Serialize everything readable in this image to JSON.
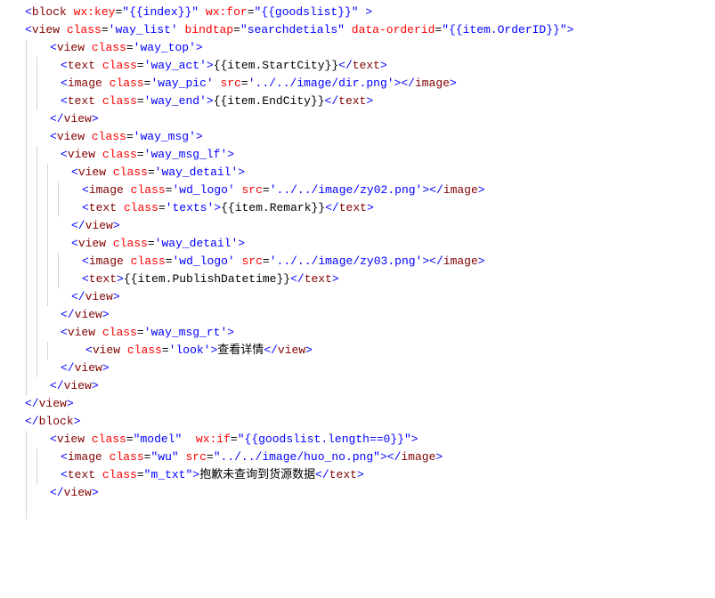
{
  "lines": [
    {
      "indent": 0,
      "parts": [
        {
          "t": "<",
          "c": "tag-angle"
        },
        {
          "t": "block",
          "c": "tag-name"
        },
        {
          "t": " "
        },
        {
          "t": "wx:key",
          "c": "attr-name"
        },
        {
          "t": "=",
          "c": "attr-eq"
        },
        {
          "t": "\"{{index}}\"",
          "c": "attr-value"
        },
        {
          "t": " "
        },
        {
          "t": "wx:for",
          "c": "attr-name"
        },
        {
          "t": "=",
          "c": "attr-eq"
        },
        {
          "t": "\"{{goodslist}}\"",
          "c": "attr-value"
        },
        {
          "t": " "
        },
        {
          "t": ">",
          "c": "tag-angle"
        }
      ],
      "guides": 0
    },
    {
      "indent": 0,
      "parts": [
        {
          "t": "<",
          "c": "tag-angle"
        },
        {
          "t": "view",
          "c": "tag-name"
        },
        {
          "t": " "
        },
        {
          "t": "class",
          "c": "attr-name"
        },
        {
          "t": "=",
          "c": "attr-eq"
        },
        {
          "t": "'way_list'",
          "c": "attr-value"
        },
        {
          "t": " "
        },
        {
          "t": "bindtap",
          "c": "attr-name"
        },
        {
          "t": "=",
          "c": "attr-eq"
        },
        {
          "t": "\"searchdetials\"",
          "c": "attr-value"
        },
        {
          "t": " "
        },
        {
          "t": "data-orderid",
          "c": "attr-name"
        },
        {
          "t": "=",
          "c": "attr-eq"
        },
        {
          "t": "\"{{item.OrderID}}\"",
          "c": "attr-value"
        },
        {
          "t": ">",
          "c": "tag-angle"
        }
      ],
      "guides": 0
    },
    {
      "indent": 2,
      "parts": [
        {
          "t": "<",
          "c": "tag-angle"
        },
        {
          "t": "view",
          "c": "tag-name"
        },
        {
          "t": " "
        },
        {
          "t": "class",
          "c": "attr-name"
        },
        {
          "t": "=",
          "c": "attr-eq"
        },
        {
          "t": "'way_top'",
          "c": "attr-value"
        },
        {
          "t": ">",
          "c": "tag-angle"
        }
      ],
      "guides": 1
    },
    {
      "indent": 3,
      "parts": [
        {
          "t": "<",
          "c": "tag-angle"
        },
        {
          "t": "text",
          "c": "tag-name"
        },
        {
          "t": " "
        },
        {
          "t": "class",
          "c": "attr-name"
        },
        {
          "t": "=",
          "c": "attr-eq"
        },
        {
          "t": "'way_act'",
          "c": "attr-value"
        },
        {
          "t": ">",
          "c": "tag-angle"
        },
        {
          "t": "{{item.StartCity}}",
          "c": "text-content"
        },
        {
          "t": "</",
          "c": "tag-angle"
        },
        {
          "t": "text",
          "c": "tag-name"
        },
        {
          "t": ">",
          "c": "tag-angle"
        }
      ],
      "guides": 2
    },
    {
      "indent": 3,
      "parts": [
        {
          "t": "<",
          "c": "tag-angle"
        },
        {
          "t": "image",
          "c": "tag-name"
        },
        {
          "t": " "
        },
        {
          "t": "class",
          "c": "attr-name"
        },
        {
          "t": "=",
          "c": "attr-eq"
        },
        {
          "t": "'way_pic'",
          "c": "attr-value"
        },
        {
          "t": " "
        },
        {
          "t": "src",
          "c": "attr-name"
        },
        {
          "t": "=",
          "c": "attr-eq"
        },
        {
          "t": "'../../image/dir.png'",
          "c": "attr-value"
        },
        {
          "t": ">",
          "c": "tag-angle"
        },
        {
          "t": "</",
          "c": "tag-angle"
        },
        {
          "t": "image",
          "c": "tag-name"
        },
        {
          "t": ">",
          "c": "tag-angle"
        }
      ],
      "guides": 2
    },
    {
      "indent": 3,
      "parts": [
        {
          "t": "<",
          "c": "tag-angle"
        },
        {
          "t": "text",
          "c": "tag-name"
        },
        {
          "t": " "
        },
        {
          "t": "class",
          "c": "attr-name"
        },
        {
          "t": "=",
          "c": "attr-eq"
        },
        {
          "t": "'way_end'",
          "c": "attr-value"
        },
        {
          "t": ">",
          "c": "tag-angle"
        },
        {
          "t": "{{item.EndCity}}",
          "c": "text-content"
        },
        {
          "t": "</",
          "c": "tag-angle"
        },
        {
          "t": "text",
          "c": "tag-name"
        },
        {
          "t": ">",
          "c": "tag-angle"
        }
      ],
      "guides": 2
    },
    {
      "indent": 2,
      "parts": [
        {
          "t": "</",
          "c": "tag-angle"
        },
        {
          "t": "view",
          "c": "tag-name"
        },
        {
          "t": ">",
          "c": "tag-angle"
        }
      ],
      "guides": 1
    },
    {
      "indent": 2,
      "parts": [
        {
          "t": "<",
          "c": "tag-angle"
        },
        {
          "t": "view",
          "c": "tag-name"
        },
        {
          "t": " "
        },
        {
          "t": "class",
          "c": "attr-name"
        },
        {
          "t": "=",
          "c": "attr-eq"
        },
        {
          "t": "'way_msg'",
          "c": "attr-value"
        },
        {
          "t": ">",
          "c": "tag-angle"
        }
      ],
      "guides": 1
    },
    {
      "indent": 3,
      "parts": [
        {
          "t": "<",
          "c": "tag-angle"
        },
        {
          "t": "view",
          "c": "tag-name"
        },
        {
          "t": " "
        },
        {
          "t": "class",
          "c": "attr-name"
        },
        {
          "t": "=",
          "c": "attr-eq"
        },
        {
          "t": "'way_msg_lf'",
          "c": "attr-value"
        },
        {
          "t": ">",
          "c": "tag-angle"
        }
      ],
      "guides": 2
    },
    {
      "indent": 4,
      "parts": [
        {
          "t": "<",
          "c": "tag-angle"
        },
        {
          "t": "view",
          "c": "tag-name"
        },
        {
          "t": " "
        },
        {
          "t": "class",
          "c": "attr-name"
        },
        {
          "t": "=",
          "c": "attr-eq"
        },
        {
          "t": "'way_detail'",
          "c": "attr-value"
        },
        {
          "t": ">",
          "c": "tag-angle"
        }
      ],
      "guides": 3
    },
    {
      "indent": 5,
      "parts": [
        {
          "t": "<",
          "c": "tag-angle"
        },
        {
          "t": "image",
          "c": "tag-name"
        },
        {
          "t": " "
        },
        {
          "t": "class",
          "c": "attr-name"
        },
        {
          "t": "=",
          "c": "attr-eq"
        },
        {
          "t": "'wd_logo'",
          "c": "attr-value"
        },
        {
          "t": " "
        },
        {
          "t": "src",
          "c": "attr-name"
        },
        {
          "t": "=",
          "c": "attr-eq"
        },
        {
          "t": "'../../image/zy02.png'",
          "c": "attr-value"
        },
        {
          "t": ">",
          "c": "tag-angle"
        },
        {
          "t": "</",
          "c": "tag-angle"
        },
        {
          "t": "image",
          "c": "tag-name"
        },
        {
          "t": ">",
          "c": "tag-angle"
        }
      ],
      "guides": 4
    },
    {
      "indent": 5,
      "parts": [
        {
          "t": "<",
          "c": "tag-angle"
        },
        {
          "t": "text",
          "c": "tag-name"
        },
        {
          "t": " "
        },
        {
          "t": "class",
          "c": "attr-name"
        },
        {
          "t": "=",
          "c": "attr-eq"
        },
        {
          "t": "'texts'",
          "c": "attr-value"
        },
        {
          "t": ">",
          "c": "tag-angle"
        },
        {
          "t": "{{item.Remark}}",
          "c": "text-content"
        },
        {
          "t": "</",
          "c": "tag-angle"
        },
        {
          "t": "text",
          "c": "tag-name"
        },
        {
          "t": ">",
          "c": "tag-angle"
        }
      ],
      "guides": 4
    },
    {
      "indent": 4,
      "parts": [
        {
          "t": "</",
          "c": "tag-angle"
        },
        {
          "t": "view",
          "c": "tag-name"
        },
        {
          "t": ">",
          "c": "tag-angle"
        }
      ],
      "guides": 3
    },
    {
      "indent": 4,
      "parts": [
        {
          "t": "<",
          "c": "tag-angle"
        },
        {
          "t": "view",
          "c": "tag-name"
        },
        {
          "t": " "
        },
        {
          "t": "class",
          "c": "attr-name"
        },
        {
          "t": "=",
          "c": "attr-eq"
        },
        {
          "t": "'way_detail'",
          "c": "attr-value"
        },
        {
          "t": ">",
          "c": "tag-angle"
        }
      ],
      "guides": 3
    },
    {
      "indent": 5,
      "parts": [
        {
          "t": "<",
          "c": "tag-angle"
        },
        {
          "t": "image",
          "c": "tag-name"
        },
        {
          "t": " "
        },
        {
          "t": "class",
          "c": "attr-name"
        },
        {
          "t": "=",
          "c": "attr-eq"
        },
        {
          "t": "'wd_logo'",
          "c": "attr-value"
        },
        {
          "t": " "
        },
        {
          "t": "src",
          "c": "attr-name"
        },
        {
          "t": "=",
          "c": "attr-eq"
        },
        {
          "t": "'../../image/zy03.png'",
          "c": "attr-value"
        },
        {
          "t": ">",
          "c": "tag-angle"
        },
        {
          "t": "</",
          "c": "tag-angle"
        },
        {
          "t": "image",
          "c": "tag-name"
        },
        {
          "t": ">",
          "c": "tag-angle"
        }
      ],
      "guides": 4
    },
    {
      "indent": 5,
      "parts": [
        {
          "t": "<",
          "c": "tag-angle"
        },
        {
          "t": "text",
          "c": "tag-name"
        },
        {
          "t": ">",
          "c": "tag-angle"
        },
        {
          "t": "{{item.PublishDatetime}}",
          "c": "text-content"
        },
        {
          "t": "</",
          "c": "tag-angle"
        },
        {
          "t": "text",
          "c": "tag-name"
        },
        {
          "t": ">",
          "c": "tag-angle"
        }
      ],
      "guides": 4
    },
    {
      "indent": 4,
      "parts": [
        {
          "t": "</",
          "c": "tag-angle"
        },
        {
          "t": "view",
          "c": "tag-name"
        },
        {
          "t": ">",
          "c": "tag-angle"
        }
      ],
      "guides": 3
    },
    {
      "indent": 3,
      "parts": [
        {
          "t": "</",
          "c": "tag-angle"
        },
        {
          "t": "view",
          "c": "tag-name"
        },
        {
          "t": ">",
          "c": "tag-angle"
        }
      ],
      "guides": 2
    },
    {
      "indent": 3,
      "parts": [
        {
          "t": "<",
          "c": "tag-angle"
        },
        {
          "t": "view",
          "c": "tag-name"
        },
        {
          "t": " "
        },
        {
          "t": "class",
          "c": "attr-name"
        },
        {
          "t": "=",
          "c": "attr-eq"
        },
        {
          "t": "'way_msg_rt'",
          "c": "attr-value"
        },
        {
          "t": ">",
          "c": "tag-angle"
        }
      ],
      "guides": 2
    },
    {
      "indent": 5,
      "parts": [
        {
          "t": "<",
          "c": "tag-angle"
        },
        {
          "t": "view",
          "c": "tag-name"
        },
        {
          "t": " "
        },
        {
          "t": "class",
          "c": "attr-name"
        },
        {
          "t": "=",
          "c": "attr-eq"
        },
        {
          "t": "'look'",
          "c": "attr-value"
        },
        {
          "t": ">",
          "c": "tag-angle"
        },
        {
          "t": "查看详情",
          "c": "text-content"
        },
        {
          "t": "</",
          "c": "tag-angle"
        },
        {
          "t": "view",
          "c": "tag-name"
        },
        {
          "t": ">",
          "c": "tag-angle"
        }
      ],
      "guides": 3
    },
    {
      "indent": 3,
      "parts": [
        {
          "t": "</",
          "c": "tag-angle"
        },
        {
          "t": "view",
          "c": "tag-name"
        },
        {
          "t": ">",
          "c": "tag-angle"
        }
      ],
      "guides": 2
    },
    {
      "indent": 2,
      "parts": [
        {
          "t": "</",
          "c": "tag-angle"
        },
        {
          "t": "view",
          "c": "tag-name"
        },
        {
          "t": ">",
          "c": "tag-angle"
        }
      ],
      "guides": 1
    },
    {
      "indent": 0,
      "parts": [
        {
          "t": "</",
          "c": "tag-angle"
        },
        {
          "t": "view",
          "c": "tag-name"
        },
        {
          "t": ">",
          "c": "tag-angle"
        }
      ],
      "guides": 0
    },
    {
      "indent": 0,
      "parts": [
        {
          "t": "</",
          "c": "tag-angle"
        },
        {
          "t": "block",
          "c": "tag-name"
        },
        {
          "t": ">",
          "c": "tag-angle"
        }
      ],
      "guides": 0
    },
    {
      "indent": 2,
      "parts": [
        {
          "t": "<",
          "c": "tag-angle"
        },
        {
          "t": "view",
          "c": "tag-name"
        },
        {
          "t": " "
        },
        {
          "t": "class",
          "c": "attr-name"
        },
        {
          "t": "=",
          "c": "attr-eq"
        },
        {
          "t": "\"model\"",
          "c": "attr-value"
        },
        {
          "t": "  "
        },
        {
          "t": "wx:if",
          "c": "attr-name"
        },
        {
          "t": "=",
          "c": "attr-eq"
        },
        {
          "t": "\"{{goodslist.length==0}}\"",
          "c": "attr-value"
        },
        {
          "t": ">",
          "c": "tag-angle"
        }
      ],
      "guides": 1
    },
    {
      "indent": 3,
      "parts": [
        {
          "t": "<",
          "c": "tag-angle"
        },
        {
          "t": "image",
          "c": "tag-name"
        },
        {
          "t": " "
        },
        {
          "t": "class",
          "c": "attr-name"
        },
        {
          "t": "=",
          "c": "attr-eq"
        },
        {
          "t": "\"wu\"",
          "c": "attr-value"
        },
        {
          "t": " "
        },
        {
          "t": "src",
          "c": "attr-name"
        },
        {
          "t": "=",
          "c": "attr-eq"
        },
        {
          "t": "\"../../image/huo_no.png\"",
          "c": "attr-value"
        },
        {
          "t": ">",
          "c": "tag-angle"
        },
        {
          "t": "</",
          "c": "tag-angle"
        },
        {
          "t": "image",
          "c": "tag-name"
        },
        {
          "t": ">",
          "c": "tag-angle"
        }
      ],
      "guides": 2
    },
    {
      "indent": 3,
      "parts": [
        {
          "t": "<",
          "c": "tag-angle"
        },
        {
          "t": "text",
          "c": "tag-name"
        },
        {
          "t": " "
        },
        {
          "t": "class",
          "c": "attr-name"
        },
        {
          "t": "=",
          "c": "attr-eq"
        },
        {
          "t": "\"m_txt\"",
          "c": "attr-value"
        },
        {
          "t": ">",
          "c": "tag-angle"
        },
        {
          "t": "抱歉未查询到货源数据",
          "c": "text-content"
        },
        {
          "t": "</",
          "c": "tag-angle"
        },
        {
          "t": "text",
          "c": "tag-name"
        },
        {
          "t": ">",
          "c": "tag-angle"
        }
      ],
      "guides": 2
    },
    {
      "indent": 2,
      "parts": [
        {
          "t": "</",
          "c": "tag-angle"
        },
        {
          "t": "view",
          "c": "tag-name"
        },
        {
          "t": ">",
          "c": "tag-angle"
        }
      ],
      "guides": 1
    },
    {
      "indent": 2,
      "parts": [],
      "guides": 1
    }
  ]
}
